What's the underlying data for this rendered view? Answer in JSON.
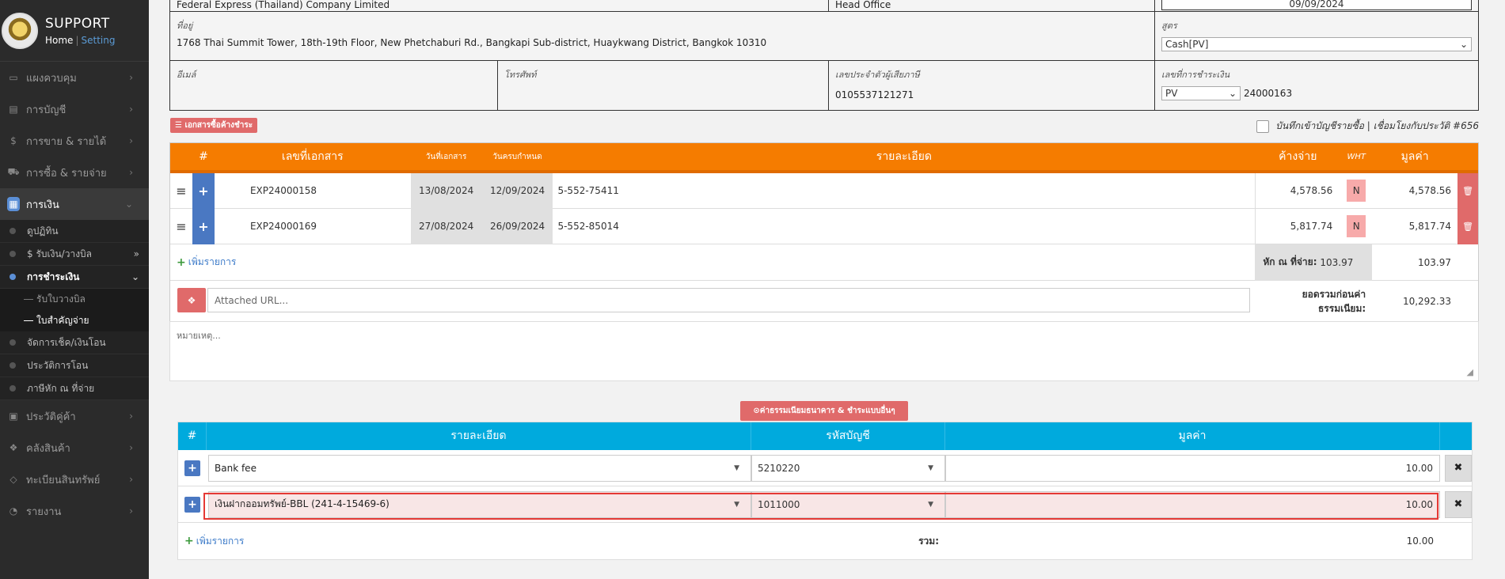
{
  "brand": {
    "title": "SUPPORT",
    "home": "Home",
    "sep": "|",
    "setting": "Setting"
  },
  "sidebar": {
    "items": [
      {
        "label": "แผงควบคุม",
        "icon": "monitor-icon"
      },
      {
        "label": "การบัญชี",
        "icon": "ledger-icon"
      },
      {
        "label": "การขาย & รายได้",
        "icon": "dollar-icon"
      },
      {
        "label": "การซื้อ & รายจ่าย",
        "icon": "cart-icon"
      },
      {
        "label": "การเงิน",
        "icon": "calendar-icon"
      }
    ],
    "finance_sub": [
      {
        "label": "ดูปฏิทิน"
      },
      {
        "label": "$ รับเงิน/วางบิล"
      },
      {
        "label": "การชำระเงิน"
      }
    ],
    "payment_sub": [
      {
        "label": "รับใบวางบิล"
      },
      {
        "label": "ใบสำคัญจ่าย"
      }
    ],
    "finance_sub2": [
      {
        "label": "จัดการเช็ค/เงินโอน"
      },
      {
        "label": "ประวัติการโอน"
      },
      {
        "label": "ภาษีหัก ณ ที่จ่าย"
      }
    ],
    "items2": [
      {
        "label": "ประวัติคู่ค้า",
        "icon": "contacts-icon"
      },
      {
        "label": "คลังสินค้า",
        "icon": "boxes-icon"
      },
      {
        "label": "ทะเบียนสินทรัพย์",
        "icon": "diamond-icon"
      },
      {
        "label": "รายงาน",
        "icon": "report-icon"
      }
    ]
  },
  "info": {
    "company": "Federal Express (Thailand) Company Limited",
    "branch": "Head Office",
    "date": "09/09/2024",
    "address_label": "ที่อยู่",
    "address": "1768 Thai Summit Tower, 18th-19th Floor, New Phetchaburi Rd., Bangkapi Sub-district, Huaykwang District, Bangkok 10310",
    "formula_label": "สูตร",
    "formula": "Cash[PV]",
    "email_label": "อีเมล์",
    "phone_label": "โทรศัพท์",
    "tax_label": "เลขประจำตัวผู้เสียภาษี",
    "tax_id": "0105537121271",
    "payno_label": "เลขที่การชำระเงิน",
    "payno_prefix": "PV",
    "payno": "24000163"
  },
  "doc_btn": "เอกสารซื้อค้างชำระ",
  "record_label": "บันทึกเข้าบัญชีรายซื้อ | เชื่อมโยงกับประวัติ #656",
  "doc_table": {
    "headers": {
      "num": "#",
      "docno": "เลขที่เอกสาร",
      "docdate": "วันที่เอกสาร",
      "duedate": "วันครบกำหนด",
      "detail": "รายละเอียด",
      "outstanding": "ค้างจ่าย",
      "wht": "WHT",
      "value": "มูลค่า"
    },
    "rows": [
      {
        "docno": "EXP24000158",
        "docdate": "13/08/2024",
        "duedate": "12/09/2024",
        "detail": "5-552-75411",
        "outstanding": "4,578.56",
        "wht": "N",
        "value": "4,578.56"
      },
      {
        "docno": "EXP24000169",
        "docdate": "27/08/2024",
        "duedate": "26/09/2024",
        "detail": "5-552-85014",
        "outstanding": "5,817.74",
        "wht": "N",
        "value": "5,817.74"
      }
    ],
    "add_label": "เพิ่มรายการ",
    "wht_label": "หัก ณ ที่จ่าย:",
    "wht_value": "103.97",
    "wht_total": "103.97",
    "subtotal_label1": "ยอดรวมก่อนค่า",
    "subtotal_label2": "ธรรมเนียม:",
    "subtotal": "10,292.33"
  },
  "url_placeholder": "Attached URL...",
  "note_placeholder": "หมายเหตุ...",
  "fee_btn": "ค่าธรรมเนียมธนาคาร & ชำระแบบอื่นๆ",
  "fee_table": {
    "headers": {
      "num": "#",
      "detail": "รายละเอียด",
      "account": "รหัสบัญชี",
      "value": "มูลค่า"
    },
    "rows": [
      {
        "detail": "Bank fee",
        "account": "5210220",
        "value": "10.00"
      },
      {
        "detail": "เงินฝากออมทรัพย์-BBL (241-4-15469-6)",
        "account": "1011000",
        "value": "10.00"
      }
    ],
    "add_label": "เพิ่มรายการ",
    "total_label": "รวม:",
    "total": "10.00"
  },
  "colors": {
    "orange_header": "#f57c00",
    "blue_header": "#00aadd",
    "red_button": "#e06a6a",
    "sidebar": "#2b2b2b"
  }
}
